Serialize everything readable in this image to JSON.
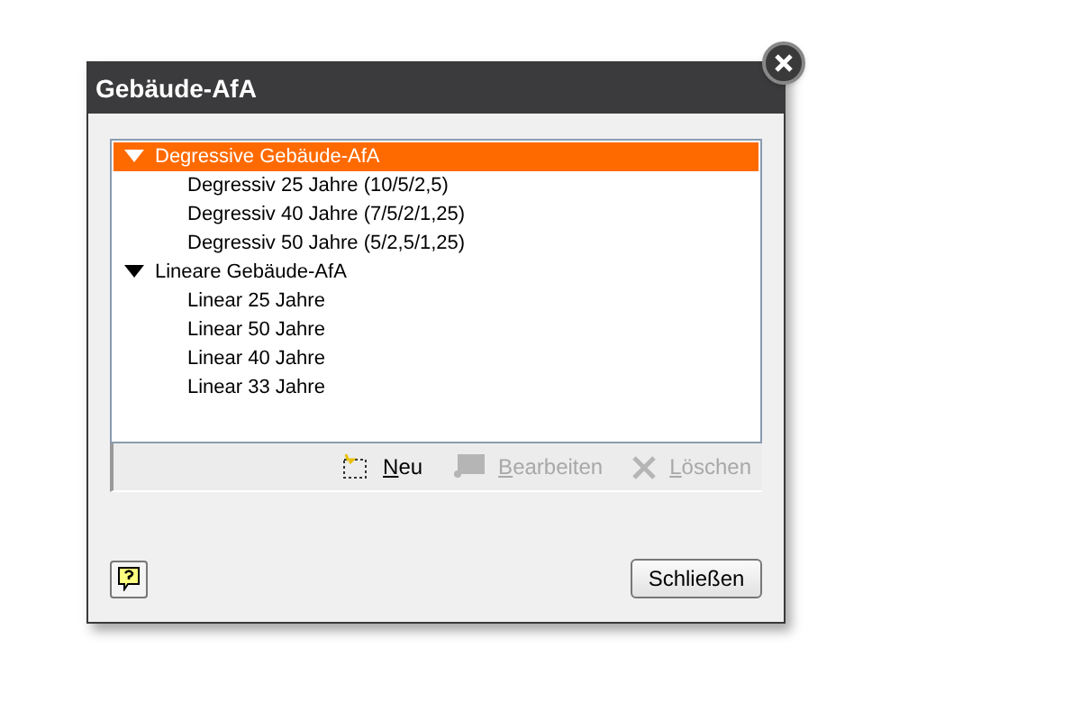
{
  "window": {
    "title": "Gebäude-AfA"
  },
  "tree": [
    {
      "label": "Degressive Gebäude-AfA",
      "selected": true,
      "expanded": true,
      "children": [
        {
          "label": "Degressiv 25 Jahre (10/5/2,5)",
          "selected": false
        },
        {
          "label": "Degressiv 40 Jahre (7/5/2/1,25)",
          "selected": false
        },
        {
          "label": "Degressiv 50 Jahre (5/2,5/1,25)",
          "selected": false
        }
      ]
    },
    {
      "label": "Lineare Gebäude-AfA",
      "selected": false,
      "expanded": true,
      "children": [
        {
          "label": "Linear 25 Jahre",
          "selected": false
        },
        {
          "label": "Linear 50 Jahre",
          "selected": false
        },
        {
          "label": "Linear 40 Jahre",
          "selected": false
        },
        {
          "label": "Linear 33 Jahre",
          "selected": false
        }
      ]
    }
  ],
  "toolbar": [
    {
      "kind": "new",
      "label": "Neu",
      "disabled": false
    },
    {
      "kind": "edit",
      "label": "Bearbeiten",
      "disabled": true
    },
    {
      "kind": "delete",
      "label": "Löschen",
      "disabled": true
    }
  ],
  "buttons": [
    {
      "label": "Schließen"
    }
  ]
}
